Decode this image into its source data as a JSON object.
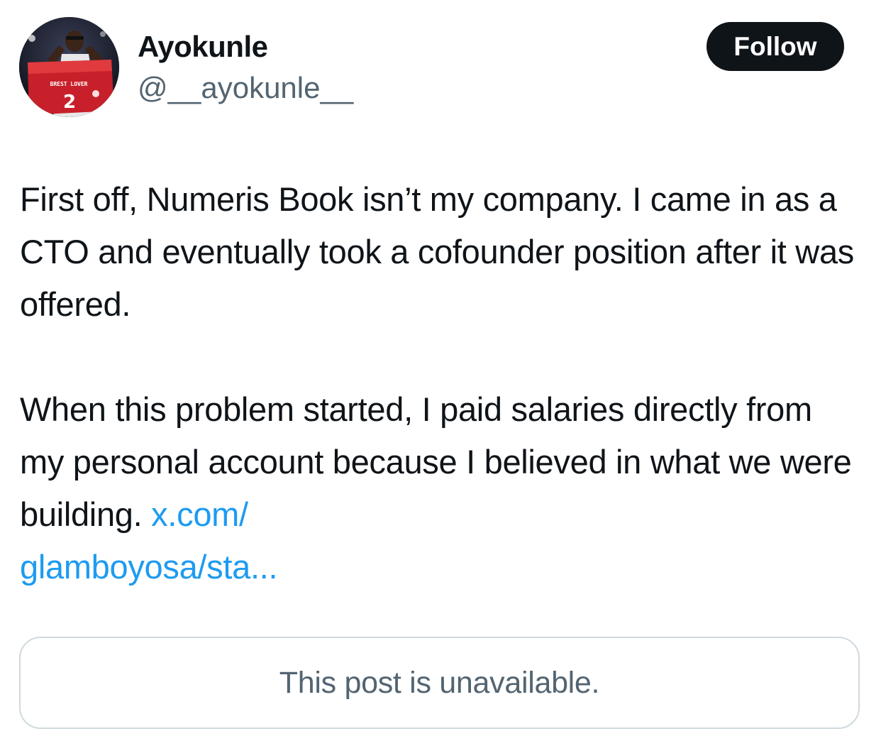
{
  "author": {
    "display_name": "Ayokunle",
    "handle": "@__ayokunle__",
    "avatar_shirt_text": "BREST LOVER",
    "avatar_shirt_number": "2"
  },
  "follow_button": {
    "label": "Follow"
  },
  "tweet": {
    "paragraph_1": "First off, Numeris Book isn’t my company. I came in as a CTO and eventually took a cofounder position after it was offered.",
    "paragraph_2_text": "When this problem started, I paid salaries directly from my personal account because I believed in what we were building.",
    "link_line_1": "x.com/",
    "link_line_2": "glamboyosa/sta..."
  },
  "quoted_post": {
    "message": "This post is unavailable."
  },
  "colors": {
    "text_primary": "#0f1419",
    "text_secondary": "#536471",
    "link": "#1d9bf0",
    "button_bg": "#0f1419",
    "border": "#cfd9de"
  }
}
